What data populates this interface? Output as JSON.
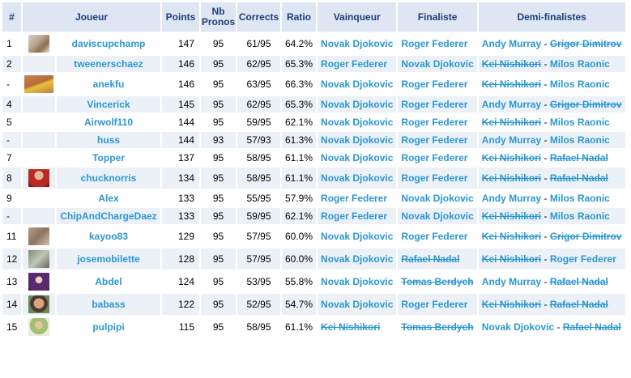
{
  "columns": {
    "rank": "#",
    "player": "Joueur",
    "points": "Points",
    "nb": "Nb",
    "pronos": "Pronos",
    "corrects": "Corrects",
    "ratio": "Ratio",
    "winner": "Vainqueur",
    "finalist": "Finaliste",
    "semis": "Demi-finalistes"
  },
  "rows": [
    {
      "rank": "1",
      "avatar": "av-news",
      "player": "daviscupchamp",
      "points": "147",
      "pronos": "95",
      "corrects": "61/95",
      "ratio": "64.2%",
      "winner": "Novak Djokovic",
      "winner_elim": false,
      "finalist": "Roger Federer",
      "finalist_elim": false,
      "semi1": "Andy Murray",
      "semi1_elim": false,
      "semi2": "Grigor Dimitrov",
      "semi2_elim": true
    },
    {
      "rank": "2",
      "avatar": "",
      "player": "tweenerschaez",
      "points": "146",
      "pronos": "95",
      "corrects": "62/95",
      "ratio": "65.3%",
      "winner": "Roger Federer",
      "winner_elim": false,
      "finalist": "Novak Djokovic",
      "finalist_elim": false,
      "semi1": "Kei Nishikori",
      "semi1_elim": true,
      "semi2": "Milos Raonic",
      "semi2_elim": false
    },
    {
      "rank": "-",
      "avatar": "av-tennis",
      "player": "anekfu",
      "points": "146",
      "pronos": "95",
      "corrects": "63/95",
      "ratio": "66.3%",
      "winner": "Novak Djokovic",
      "winner_elim": false,
      "finalist": "Roger Federer",
      "finalist_elim": false,
      "semi1": "Kei Nishikori",
      "semi1_elim": true,
      "semi2": "Milos Raonic",
      "semi2_elim": false
    },
    {
      "rank": "4",
      "avatar": "",
      "player": "Vincerick",
      "points": "145",
      "pronos": "95",
      "corrects": "62/95",
      "ratio": "65.3%",
      "winner": "Novak Djokovic",
      "winner_elim": false,
      "finalist": "Roger Federer",
      "finalist_elim": false,
      "semi1": "Andy Murray",
      "semi1_elim": false,
      "semi2": "Grigor Dimitrov",
      "semi2_elim": true
    },
    {
      "rank": "5",
      "avatar": "",
      "player": "Airwolf110",
      "points": "144",
      "pronos": "95",
      "corrects": "59/95",
      "ratio": "62.1%",
      "winner": "Novak Djokovic",
      "winner_elim": false,
      "finalist": "Roger Federer",
      "finalist_elim": false,
      "semi1": "Kei Nishikori",
      "semi1_elim": true,
      "semi2": "Milos Raonic",
      "semi2_elim": false
    },
    {
      "rank": "-",
      "avatar": "",
      "player": "huss",
      "points": "144",
      "pronos": "93",
      "corrects": "57/93",
      "ratio": "61.3%",
      "winner": "Novak Djokovic",
      "winner_elim": false,
      "finalist": "Roger Federer",
      "finalist_elim": false,
      "semi1": "Andy Murray",
      "semi1_elim": false,
      "semi2": "Milos Raonic",
      "semi2_elim": false
    },
    {
      "rank": "7",
      "avatar": "",
      "player": "Topper",
      "points": "137",
      "pronos": "95",
      "corrects": "58/95",
      "ratio": "61.1%",
      "winner": "Novak Djokovic",
      "winner_elim": false,
      "finalist": "Roger Federer",
      "finalist_elim": false,
      "semi1": "Kei Nishikori",
      "semi1_elim": true,
      "semi2": "Rafael Nadal",
      "semi2_elim": true
    },
    {
      "rank": "8",
      "avatar": "av-red",
      "player": "chucknorris",
      "points": "134",
      "pronos": "95",
      "corrects": "58/95",
      "ratio": "61.1%",
      "winner": "Novak Djokovic",
      "winner_elim": false,
      "finalist": "Roger Federer",
      "finalist_elim": false,
      "semi1": "Kei Nishikori",
      "semi1_elim": true,
      "semi2": "Rafael Nadal",
      "semi2_elim": true
    },
    {
      "rank": "9",
      "avatar": "",
      "player": "Alex",
      "points": "133",
      "pronos": "95",
      "corrects": "55/95",
      "ratio": "57.9%",
      "winner": "Roger Federer",
      "winner_elim": false,
      "finalist": "Novak Djokovic",
      "finalist_elim": false,
      "semi1": "Andy Murray",
      "semi1_elim": false,
      "semi2": "Milos Raonic",
      "semi2_elim": false
    },
    {
      "rank": "-",
      "avatar": "",
      "player": "ChipAndChargeDaez",
      "points": "133",
      "pronos": "95",
      "corrects": "59/95",
      "ratio": "62.1%",
      "winner": "Roger Federer",
      "winner_elim": false,
      "finalist": "Novak Djokovic",
      "finalist_elim": false,
      "semi1": "Kei Nishikori",
      "semi1_elim": true,
      "semi2": "Milos Raonic",
      "semi2_elim": false
    },
    {
      "rank": "11",
      "avatar": "av-crowd",
      "player": "kayoo83",
      "points": "129",
      "pronos": "95",
      "corrects": "57/95",
      "ratio": "60.0%",
      "winner": "Novak Djokovic",
      "winner_elim": false,
      "finalist": "Roger Federer",
      "finalist_elim": false,
      "semi1": "Kei Nishikori",
      "semi1_elim": true,
      "semi2": "Grigor Dimitrov",
      "semi2_elim": true
    },
    {
      "rank": "12",
      "avatar": "av-wheel",
      "player": "josemobilette",
      "points": "128",
      "pronos": "95",
      "corrects": "57/95",
      "ratio": "60.0%",
      "winner": "Novak Djokovic",
      "winner_elim": false,
      "finalist": "Rafael Nadal",
      "finalist_elim": true,
      "semi1": "Kei Nishikori",
      "semi1_elim": true,
      "semi2": "Roger Federer",
      "semi2_elim": false
    },
    {
      "rank": "13",
      "avatar": "av-purple",
      "player": "Abdel",
      "points": "124",
      "pronos": "95",
      "corrects": "53/95",
      "ratio": "55.8%",
      "winner": "Novak Djokovic",
      "winner_elim": false,
      "finalist": "Tomas Berdych",
      "finalist_elim": true,
      "semi1": "Andy Murray",
      "semi1_elim": false,
      "semi2": "Rafael Nadal",
      "semi2_elim": true
    },
    {
      "rank": "14",
      "avatar": "av-face",
      "player": "babass",
      "points": "122",
      "pronos": "95",
      "corrects": "52/95",
      "ratio": "54.7%",
      "winner": "Novak Djokovic",
      "winner_elim": false,
      "finalist": "Roger Federer",
      "finalist_elim": false,
      "semi1": "Kei Nishikori",
      "semi1_elim": true,
      "semi2": "Rafael Nadal",
      "semi2_elim": true
    },
    {
      "rank": "15",
      "avatar": "av-small",
      "player": "pulpipi",
      "points": "115",
      "pronos": "95",
      "corrects": "58/95",
      "ratio": "61.1%",
      "winner": "Kei Nishikori",
      "winner_elim": true,
      "finalist": "Tomas Berdych",
      "finalist_elim": true,
      "semi1": "Novak Djokovic",
      "semi1_elim": false,
      "semi2": "Rafael Nadal",
      "semi2_elim": true
    }
  ]
}
